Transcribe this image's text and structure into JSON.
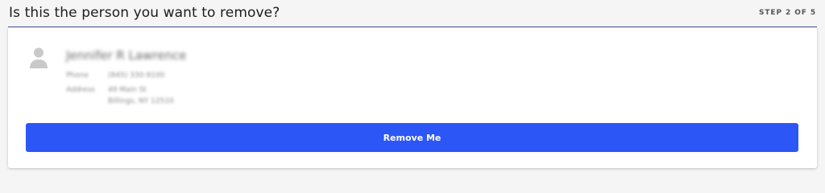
{
  "header": {
    "title": "Is this the person you want to remove?",
    "step": "STEP 2 OF 5"
  },
  "person": {
    "name": "Jennifer R Lawrence",
    "phone_label": "Phone",
    "phone_value": "(845) 330-9100",
    "address_label": "Address",
    "address_line1": "49 Main St",
    "address_line2": "Billings, NY 12510"
  },
  "actions": {
    "remove_label": "Remove Me"
  },
  "colors": {
    "accent": "#2d56f6",
    "divider": "#3a4a9c"
  },
  "icons": {
    "avatar": "person-icon"
  }
}
